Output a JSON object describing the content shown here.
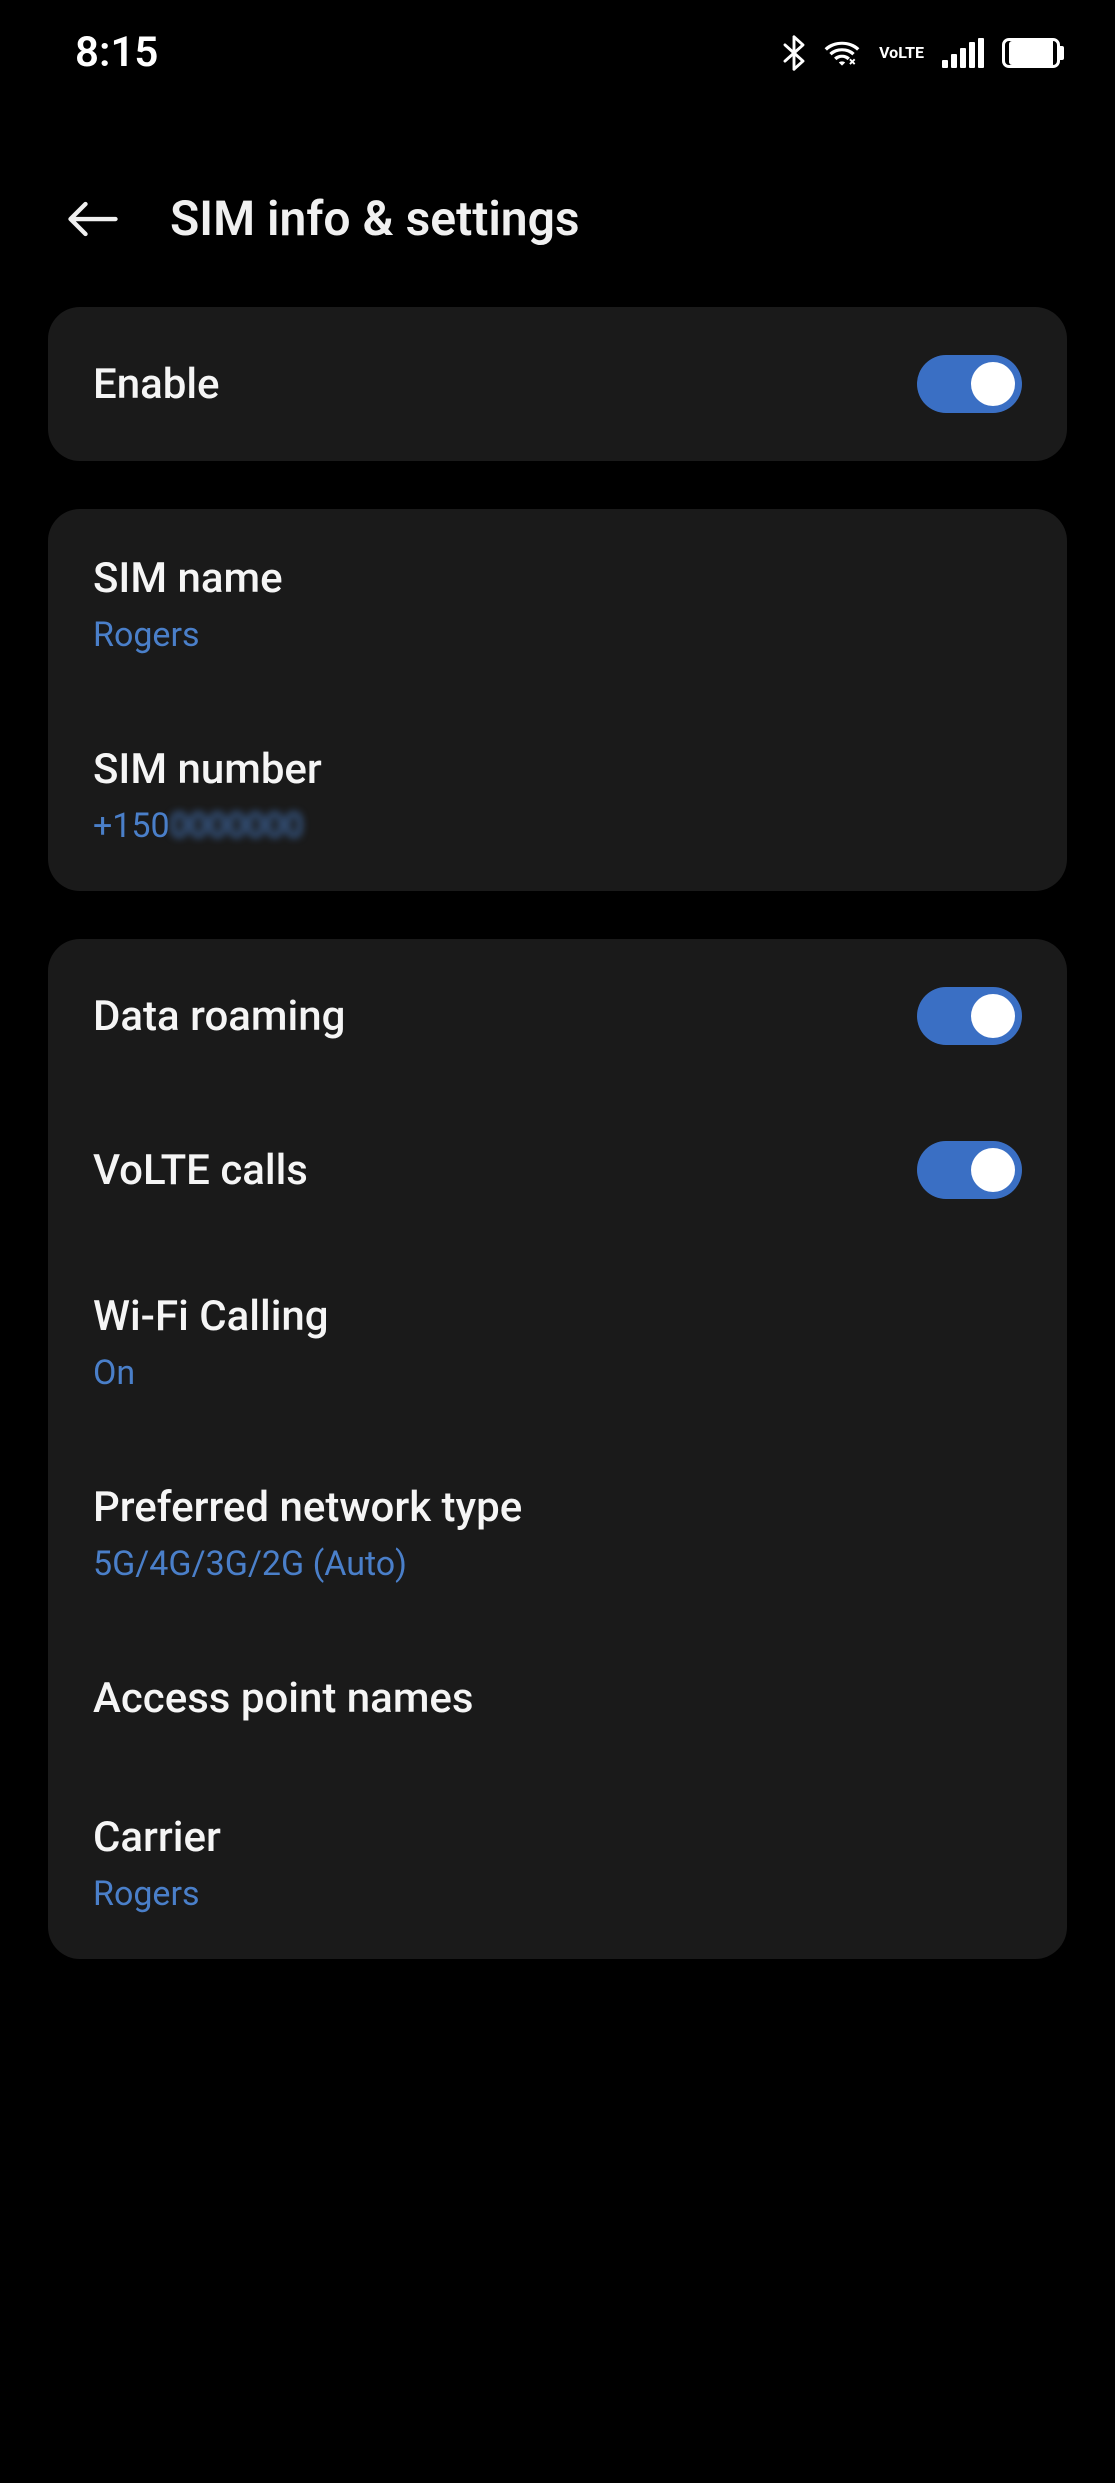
{
  "status_bar": {
    "time": "8:15",
    "volte_line1": "Vo",
    "volte_line2": "LTE"
  },
  "header": {
    "title": "SIM info & settings"
  },
  "enable": {
    "label": "Enable",
    "on": true
  },
  "sim_info": {
    "name_label": "SIM name",
    "name_value": "Rogers",
    "number_label": "SIM number",
    "number_value": "+150"
  },
  "network": {
    "data_roaming_label": "Data roaming",
    "data_roaming_on": true,
    "volte_label": "VoLTE calls",
    "volte_on": true,
    "wifi_calling_label": "Wi-Fi Calling",
    "wifi_calling_value": "On",
    "preferred_network_label": "Preferred network type",
    "preferred_network_value": "5G/4G/3G/2G (Auto)",
    "apn_label": "Access point names",
    "carrier_label": "Carrier",
    "carrier_value": "Rogers"
  }
}
